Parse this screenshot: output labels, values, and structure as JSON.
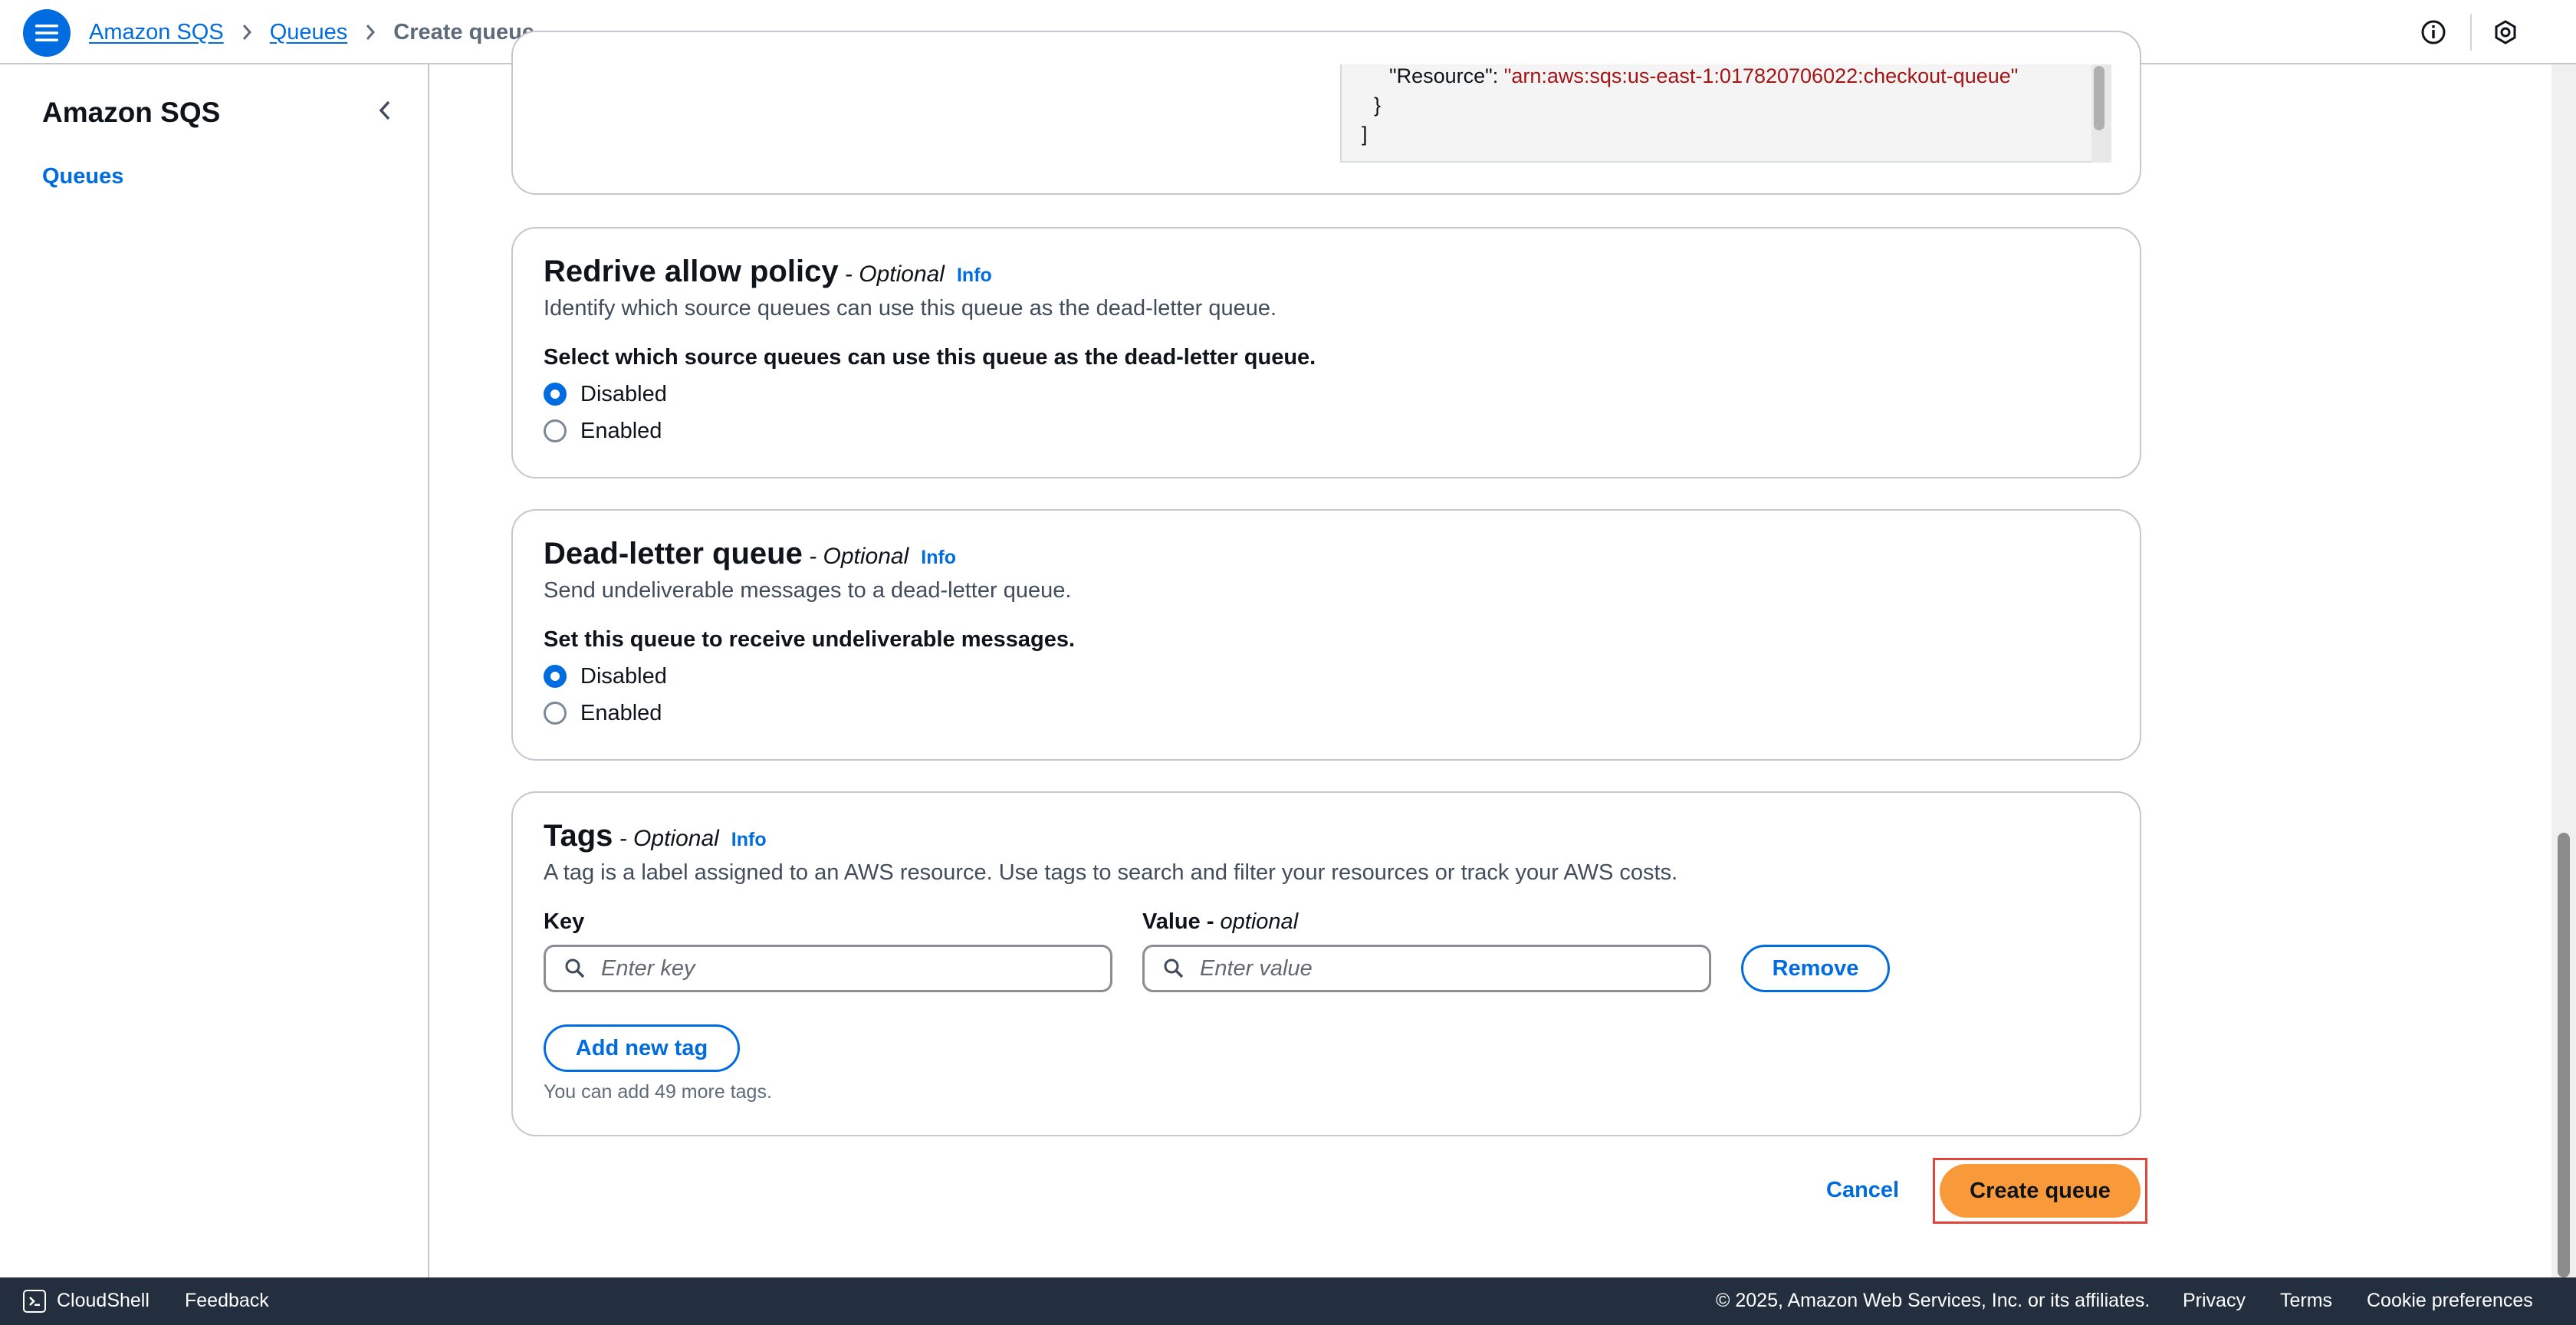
{
  "header": {
    "breadcrumbs": [
      "Amazon SQS",
      "Queues"
    ],
    "current": "Create queue"
  },
  "sidenav": {
    "title": "Amazon SQS",
    "items": [
      "Queues"
    ]
  },
  "policy_editor": {
    "line_resource_key": "\"Resource\": ",
    "line_resource_value": "\"arn:aws:sqs:us-east-1:017820706022:checkout-queue\"",
    "line_brace": "}",
    "line_bracket": "]"
  },
  "redrive": {
    "title": "Redrive allow policy",
    "optional": " - Optional",
    "info": "Info",
    "description": "Identify which source queues can use this queue as the dead-letter queue.",
    "question": "Select which source queues can use this queue as the dead-letter queue.",
    "options": [
      "Disabled",
      "Enabled"
    ],
    "selected": "Disabled"
  },
  "dlq": {
    "title": "Dead-letter queue",
    "optional": " - Optional",
    "info": "Info",
    "description": "Send undeliverable messages to a dead-letter queue.",
    "question": "Set this queue to receive undeliverable messages.",
    "options": [
      "Disabled",
      "Enabled"
    ],
    "selected": "Disabled"
  },
  "tags": {
    "title": "Tags",
    "optional": " - Optional",
    "info": "Info",
    "description": "A tag is a label assigned to an AWS resource. Use tags to search and filter your resources or track your AWS costs.",
    "key_label": "Key",
    "value_label": "Value - ",
    "value_optional": "optional",
    "key_placeholder": "Enter key",
    "value_placeholder": "Enter value",
    "remove_label": "Remove",
    "add_label": "Add new tag",
    "hint": "You can add 49 more tags."
  },
  "actions": {
    "cancel": "Cancel",
    "create": "Create queue"
  },
  "footer": {
    "cloudshell": "CloudShell",
    "feedback": "Feedback",
    "copyright": "© 2025, Amazon Web Services, Inc. or its affiliates.",
    "privacy": "Privacy",
    "terms": "Terms",
    "cookies": "Cookie preferences"
  },
  "colors": {
    "link": "#006ce0",
    "primary_button": "#f89a3a",
    "footer_bg": "#232f3e"
  }
}
